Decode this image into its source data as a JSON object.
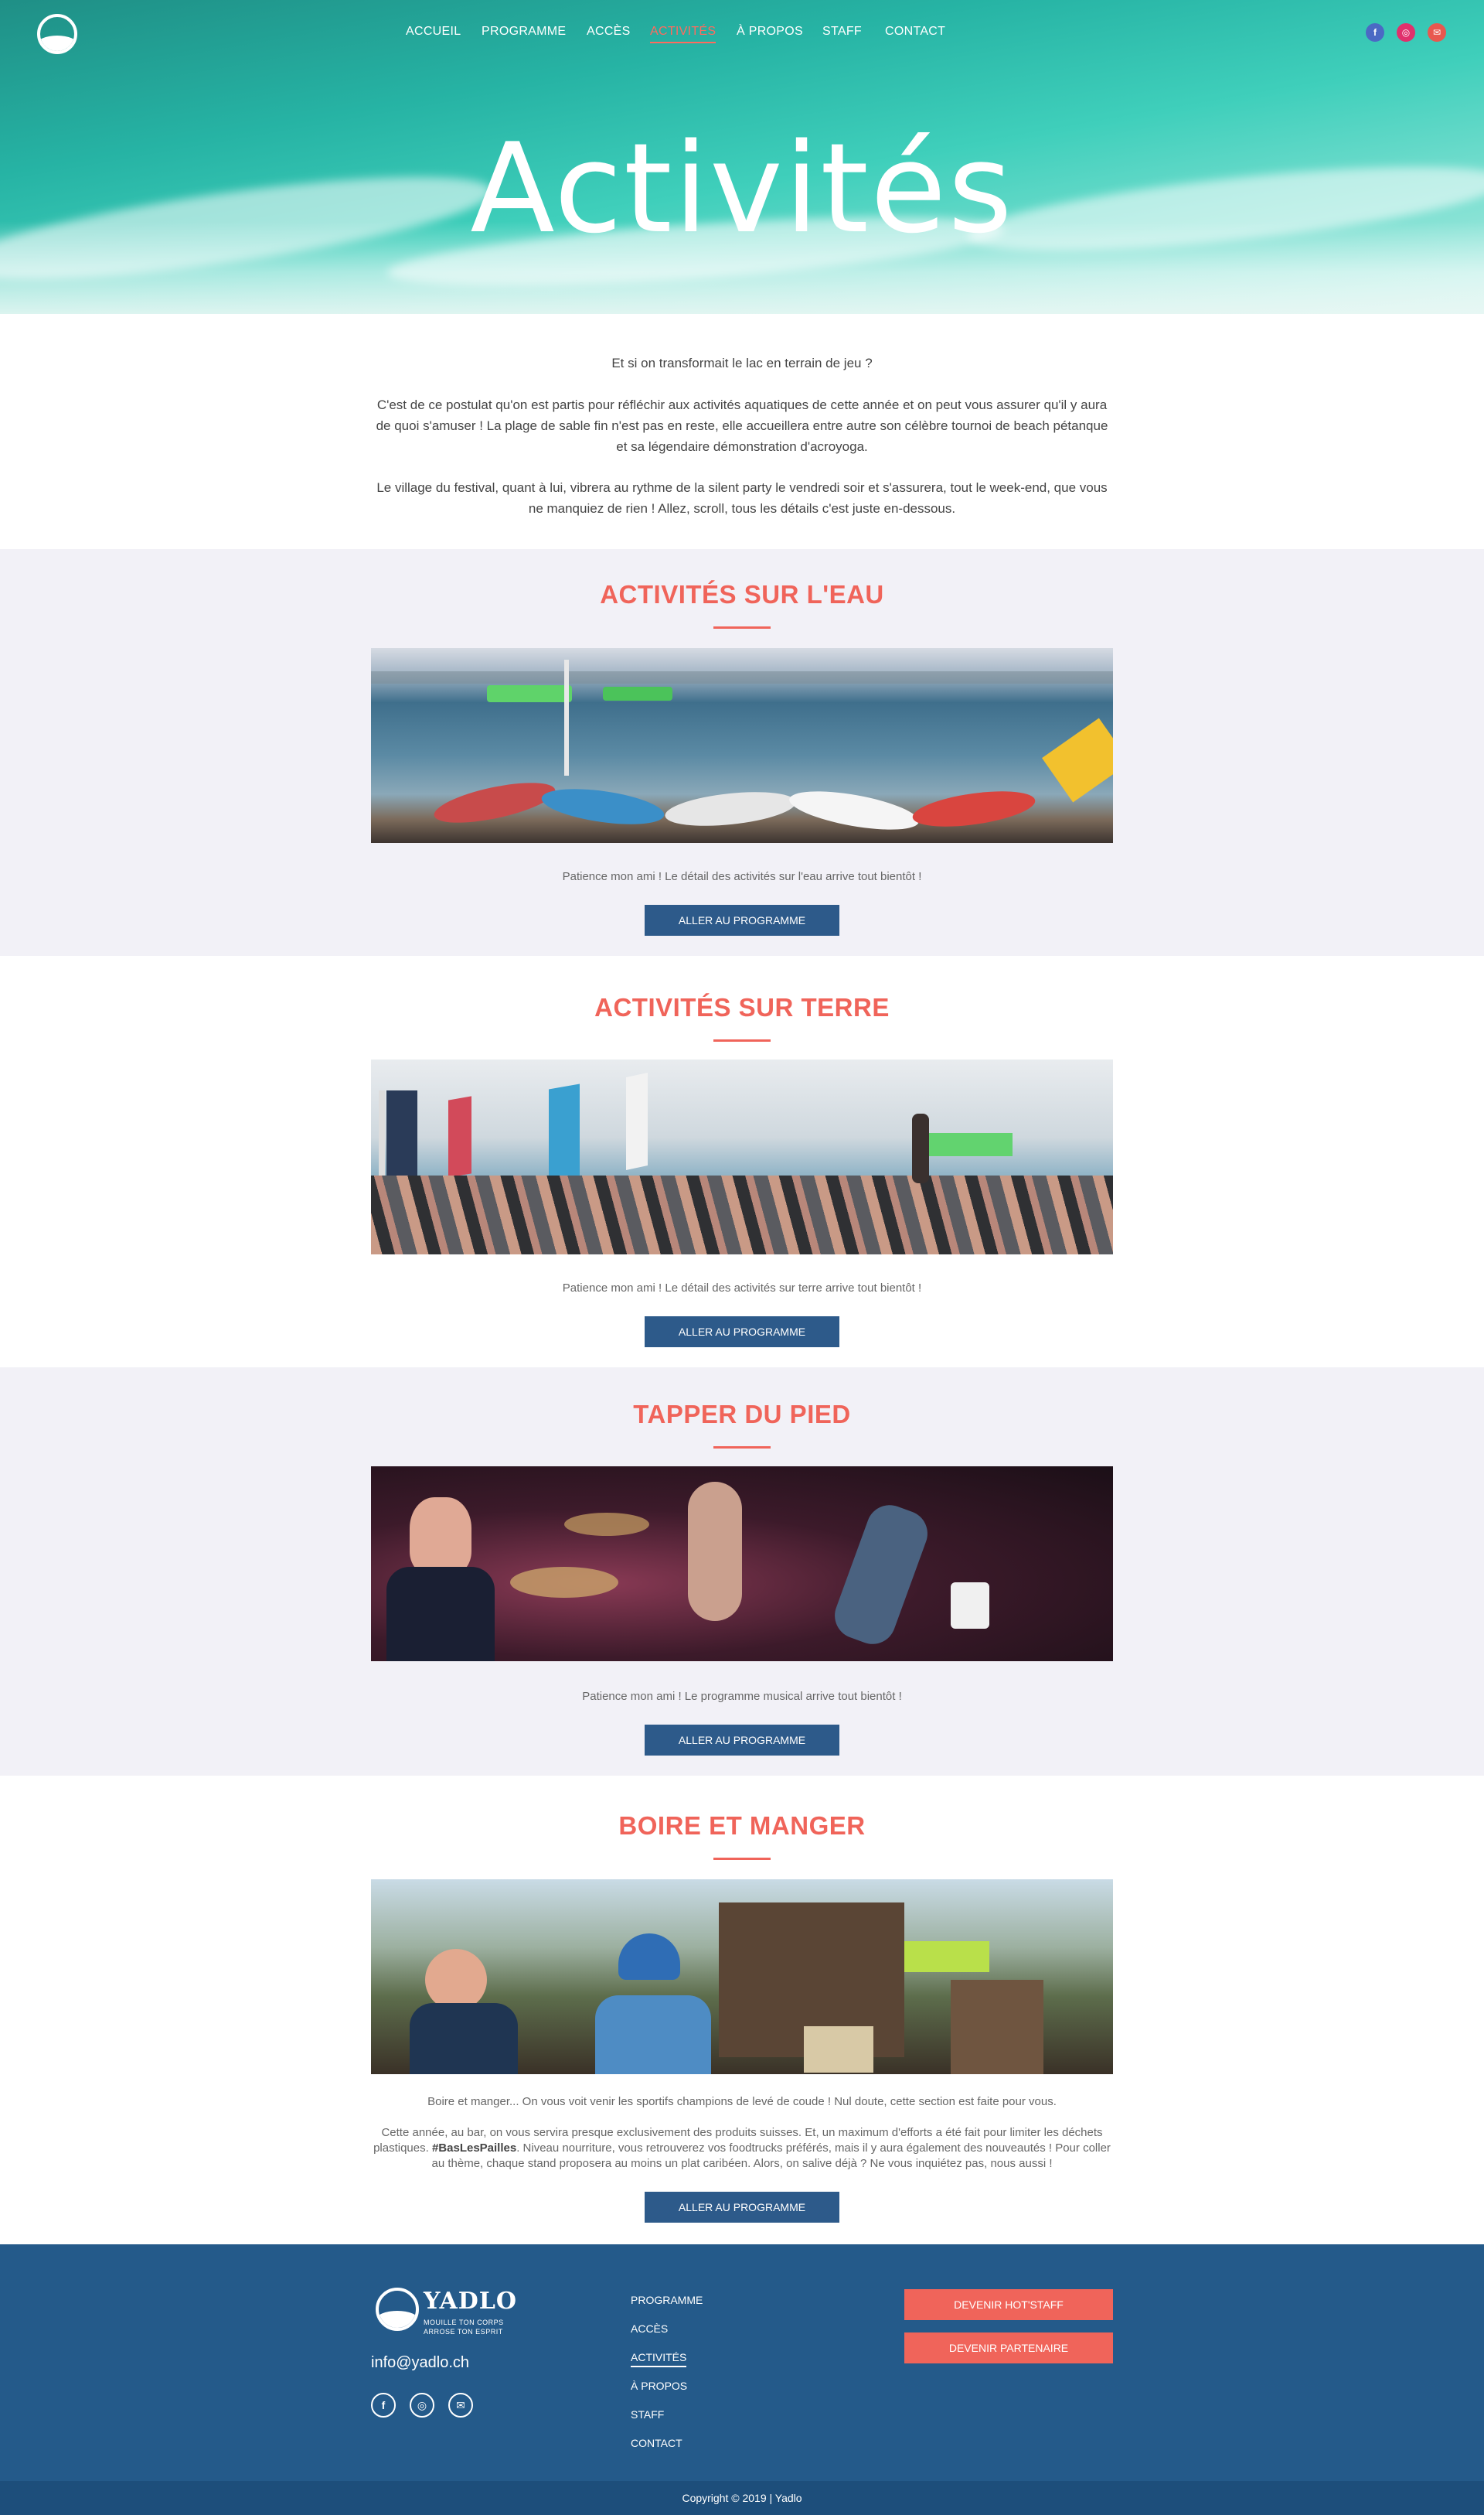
{
  "nav": {
    "items": [
      {
        "label": "ACCUEIL"
      },
      {
        "label": "PROGRAMME"
      },
      {
        "label": "ACCÈS"
      },
      {
        "label": "ACTIVITÉS"
      },
      {
        "label": "À PROPOS"
      },
      {
        "label": "STAFF"
      },
      {
        "label": "CONTACT"
      }
    ],
    "active": "ACTIVITÉS",
    "social_icons": [
      "facebook-icon",
      "instagram-icon",
      "mail-icon"
    ]
  },
  "hero": {
    "title": "Activités"
  },
  "intro": {
    "p1": "Et si on transformait le lac en terrain de jeu ?",
    "p2": "C'est de ce postulat qu'on est partis pour réfléchir aux activités aquatiques de cette année et on peut vous assurer qu'il y aura de quoi s'amuser ! La plage de sable fin n'est pas en reste, elle accueillera entre autre son célèbre tournoi de beach pétanque et sa légendaire démonstration d'acroyoga.",
    "p3": "Le village du festival, quant à lui, vibrera au rythme de la silent party le vendredi soir et s'assurera, tout le week-end, que vous ne manquiez de rien ! Allez, scroll, tous les détails c'est juste en-dessous."
  },
  "sections": [
    {
      "title": "ACTIVITÉS SUR L'EAU",
      "caption": "Patience mon ami ! Le détail des activités sur l'eau arrive tout bientôt !",
      "button": "ALLER AU PROGRAMME"
    },
    {
      "title": "ACTIVITÉS SUR TERRE",
      "caption": "Patience mon ami ! Le détail des activités sur terre arrive tout bientôt !",
      "button": "ALLER AU PROGRAMME"
    },
    {
      "title": "TAPPER DU PIED",
      "caption": "Patience mon ami ! Le programme musical arrive tout bientôt !",
      "button": "ALLER AU PROGRAMME"
    },
    {
      "title": "BOIRE ET MANGER",
      "caption": "Boire et manger... On vous voit venir les sportifs champions de levé de coude ! Nul doute, cette section est faite pour vous.",
      "caption2_before": "Cette année, au bar, on vous servira presque exclusivement des produits suisses. Et, un maximum d'efforts a été fait pour limiter les déchets plastiques. ",
      "caption2_bold": "#BasLesPailles",
      "caption2_after": ". Niveau nourriture, vous retrouverez vos foodtrucks préférés, mais il y aura également des nouveautés ! Pour coller au thème, chaque stand proposera au moins un plat caribéen. Alors, on salive déjà ? Ne vous inquiétez pas, nous aussi !",
      "button": "ALLER AU PROGRAMME"
    }
  ],
  "footer": {
    "brand": "YADLO",
    "tagline1": "MOUILLE TON CORPS",
    "tagline2": "ARROSE TON ESPRIT",
    "email": "info@yadlo.ch",
    "links": [
      "PROGRAMME",
      "ACCÈS",
      "ACTIVITÉS",
      "À PROPOS",
      "STAFF",
      "CONTACT"
    ],
    "btn_staff": "DEVENIR HOT'STAFF",
    "btn_partner": "DEVENIR PARTENAIRE",
    "copyright": "Copyright © 2019 | Yadlo"
  },
  "colors": {
    "accent": "#f0645a",
    "button": "#2d5a8a",
    "footer": "#245a8a",
    "section_alt": "#f2f1f7"
  }
}
